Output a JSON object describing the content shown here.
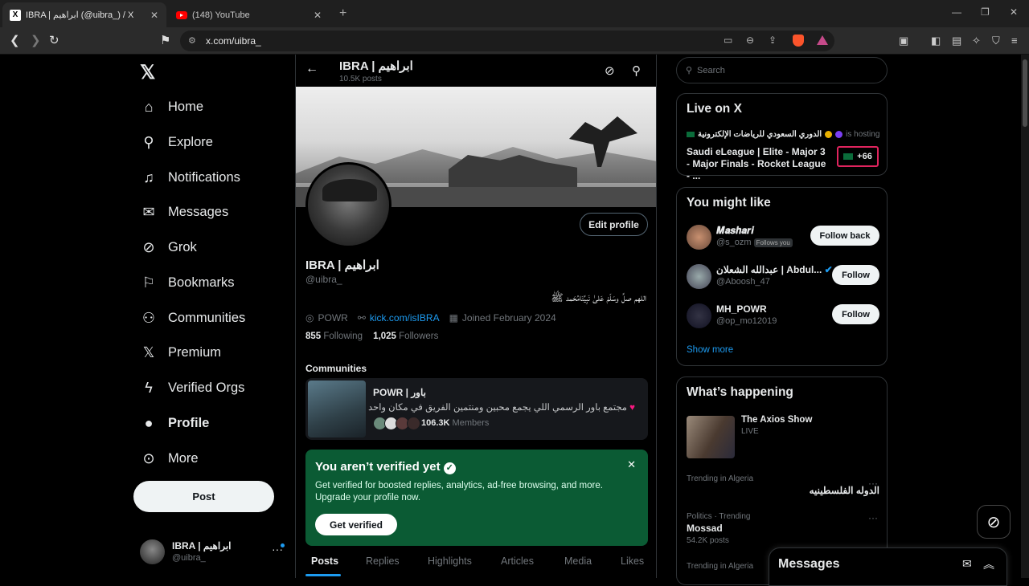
{
  "browser": {
    "tabs": [
      {
        "title": "IBRA | ابراهيم (@uibra_) / X",
        "favicon": "x-logo"
      },
      {
        "title": "(148) YouTube",
        "favicon": "youtube-logo"
      }
    ],
    "url": "x.com/uibra_"
  },
  "nav": {
    "items": [
      {
        "label": "Home",
        "icon": "home-icon"
      },
      {
        "label": "Explore",
        "icon": "search-icon"
      },
      {
        "label": "Notifications",
        "icon": "bell-icon"
      },
      {
        "label": "Messages",
        "icon": "mail-icon"
      },
      {
        "label": "Grok",
        "icon": "grok-icon"
      },
      {
        "label": "Bookmarks",
        "icon": "bookmark-icon"
      },
      {
        "label": "Communities",
        "icon": "people-icon"
      },
      {
        "label": "Premium",
        "icon": "x-icon"
      },
      {
        "label": "Verified Orgs",
        "icon": "bolt-icon"
      },
      {
        "label": "Profile",
        "icon": "person-icon"
      },
      {
        "label": "More",
        "icon": "more-circle-icon"
      }
    ],
    "post_label": "Post",
    "account": {
      "name": "IBRA | ابراهيم",
      "handle": "@uibra_"
    }
  },
  "header": {
    "title": "IBRA | ابراهيم",
    "posts": "10.5K posts"
  },
  "profile": {
    "edit_label": "Edit profile",
    "name": "IBRA | ابراهيم",
    "handle": "@uibra_",
    "bio": "اللهم صلِّ وسَلّمْ عَلىٰ نَبِيِّنَامُحَمد ﷺ",
    "location": "POWR",
    "link": "kick.com/isIBRA",
    "joined": "Joined February 2024",
    "following_count": "855",
    "following_label": "Following",
    "followers_count": "1,025",
    "followers_label": "Followers"
  },
  "communities": {
    "heading": "Communities",
    "name": "POWR | باور",
    "description": "مجتمع باور الرسمي اللي يجمع محبين ومنتمين الفريق في مكان واحد",
    "members_count": "106.3K",
    "members_label": "Members"
  },
  "verify": {
    "title": "You aren’t verified yet",
    "body": "Get verified for boosted replies, analytics, ad-free browsing, and more. Upgrade your profile now.",
    "button": "Get verified"
  },
  "profile_tabs": [
    "Posts",
    "Replies",
    "Highlights",
    "Articles",
    "Media",
    "Likes"
  ],
  "search": {
    "placeholder": "Search"
  },
  "live": {
    "heading": "Live on X",
    "host_name": "الدوري السعودي للرياضات الإلكترونية",
    "host_suffix": "is hosting",
    "title": "Saudi eLeague | Elite - Major 3 - Major Finals - Rocket League - ...",
    "count": "+66"
  },
  "you_might_like": {
    "heading": "You might like",
    "users": [
      {
        "name": "𝑴𝒂𝒔𝒉𝒂𝒓𝒊",
        "handle": "@s_ozm",
        "badge": "Follows you",
        "button": "Follow back"
      },
      {
        "name": "عبدالله الشعلان | Abdul...",
        "handle": "@Aboosh_47",
        "badge": "",
        "button": "Follow"
      },
      {
        "name": "MH_POWR",
        "handle": "@op_mo12019",
        "badge": "",
        "button": "Follow"
      }
    ],
    "show_more": "Show more"
  },
  "happening": {
    "heading": "What’s happening",
    "live_show": {
      "title": "The Axios Show",
      "status": "LIVE"
    },
    "trends": [
      {
        "meta": "Trending in Algeria",
        "name": "الدوله الفلسطينيه",
        "count": ""
      },
      {
        "meta": "Politics · Trending",
        "name": "Mossad",
        "count": "54.2K posts"
      },
      {
        "meta": "Trending in Algeria",
        "name": "",
        "count": ""
      }
    ]
  },
  "messages_drawer": {
    "title": "Messages"
  },
  "colors": {
    "accent": "#1d9bf0",
    "verify_bg": "#0b5b34",
    "live_border": "#e0245e"
  }
}
